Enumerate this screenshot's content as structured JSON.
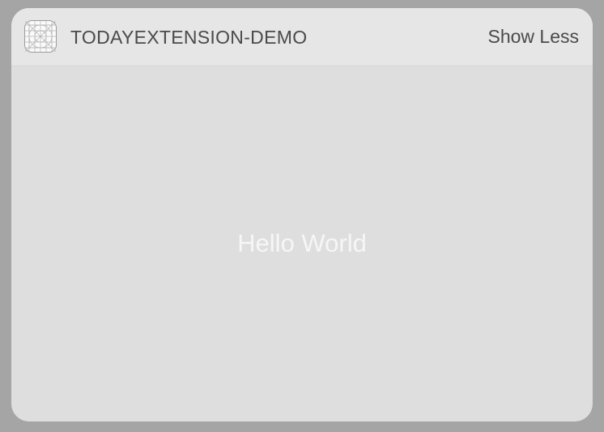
{
  "widget": {
    "app_icon": "app-grid-icon",
    "app_name": "TODAYEXTENSION-DEMO",
    "toggle_label": "Show Less",
    "body_text": "Hello World"
  },
  "colors": {
    "background": "#a5a5a5",
    "header": "#e6e6e6",
    "body": "#dedede",
    "header_text": "#4a4a4a",
    "body_text": "#f6f6f6"
  }
}
